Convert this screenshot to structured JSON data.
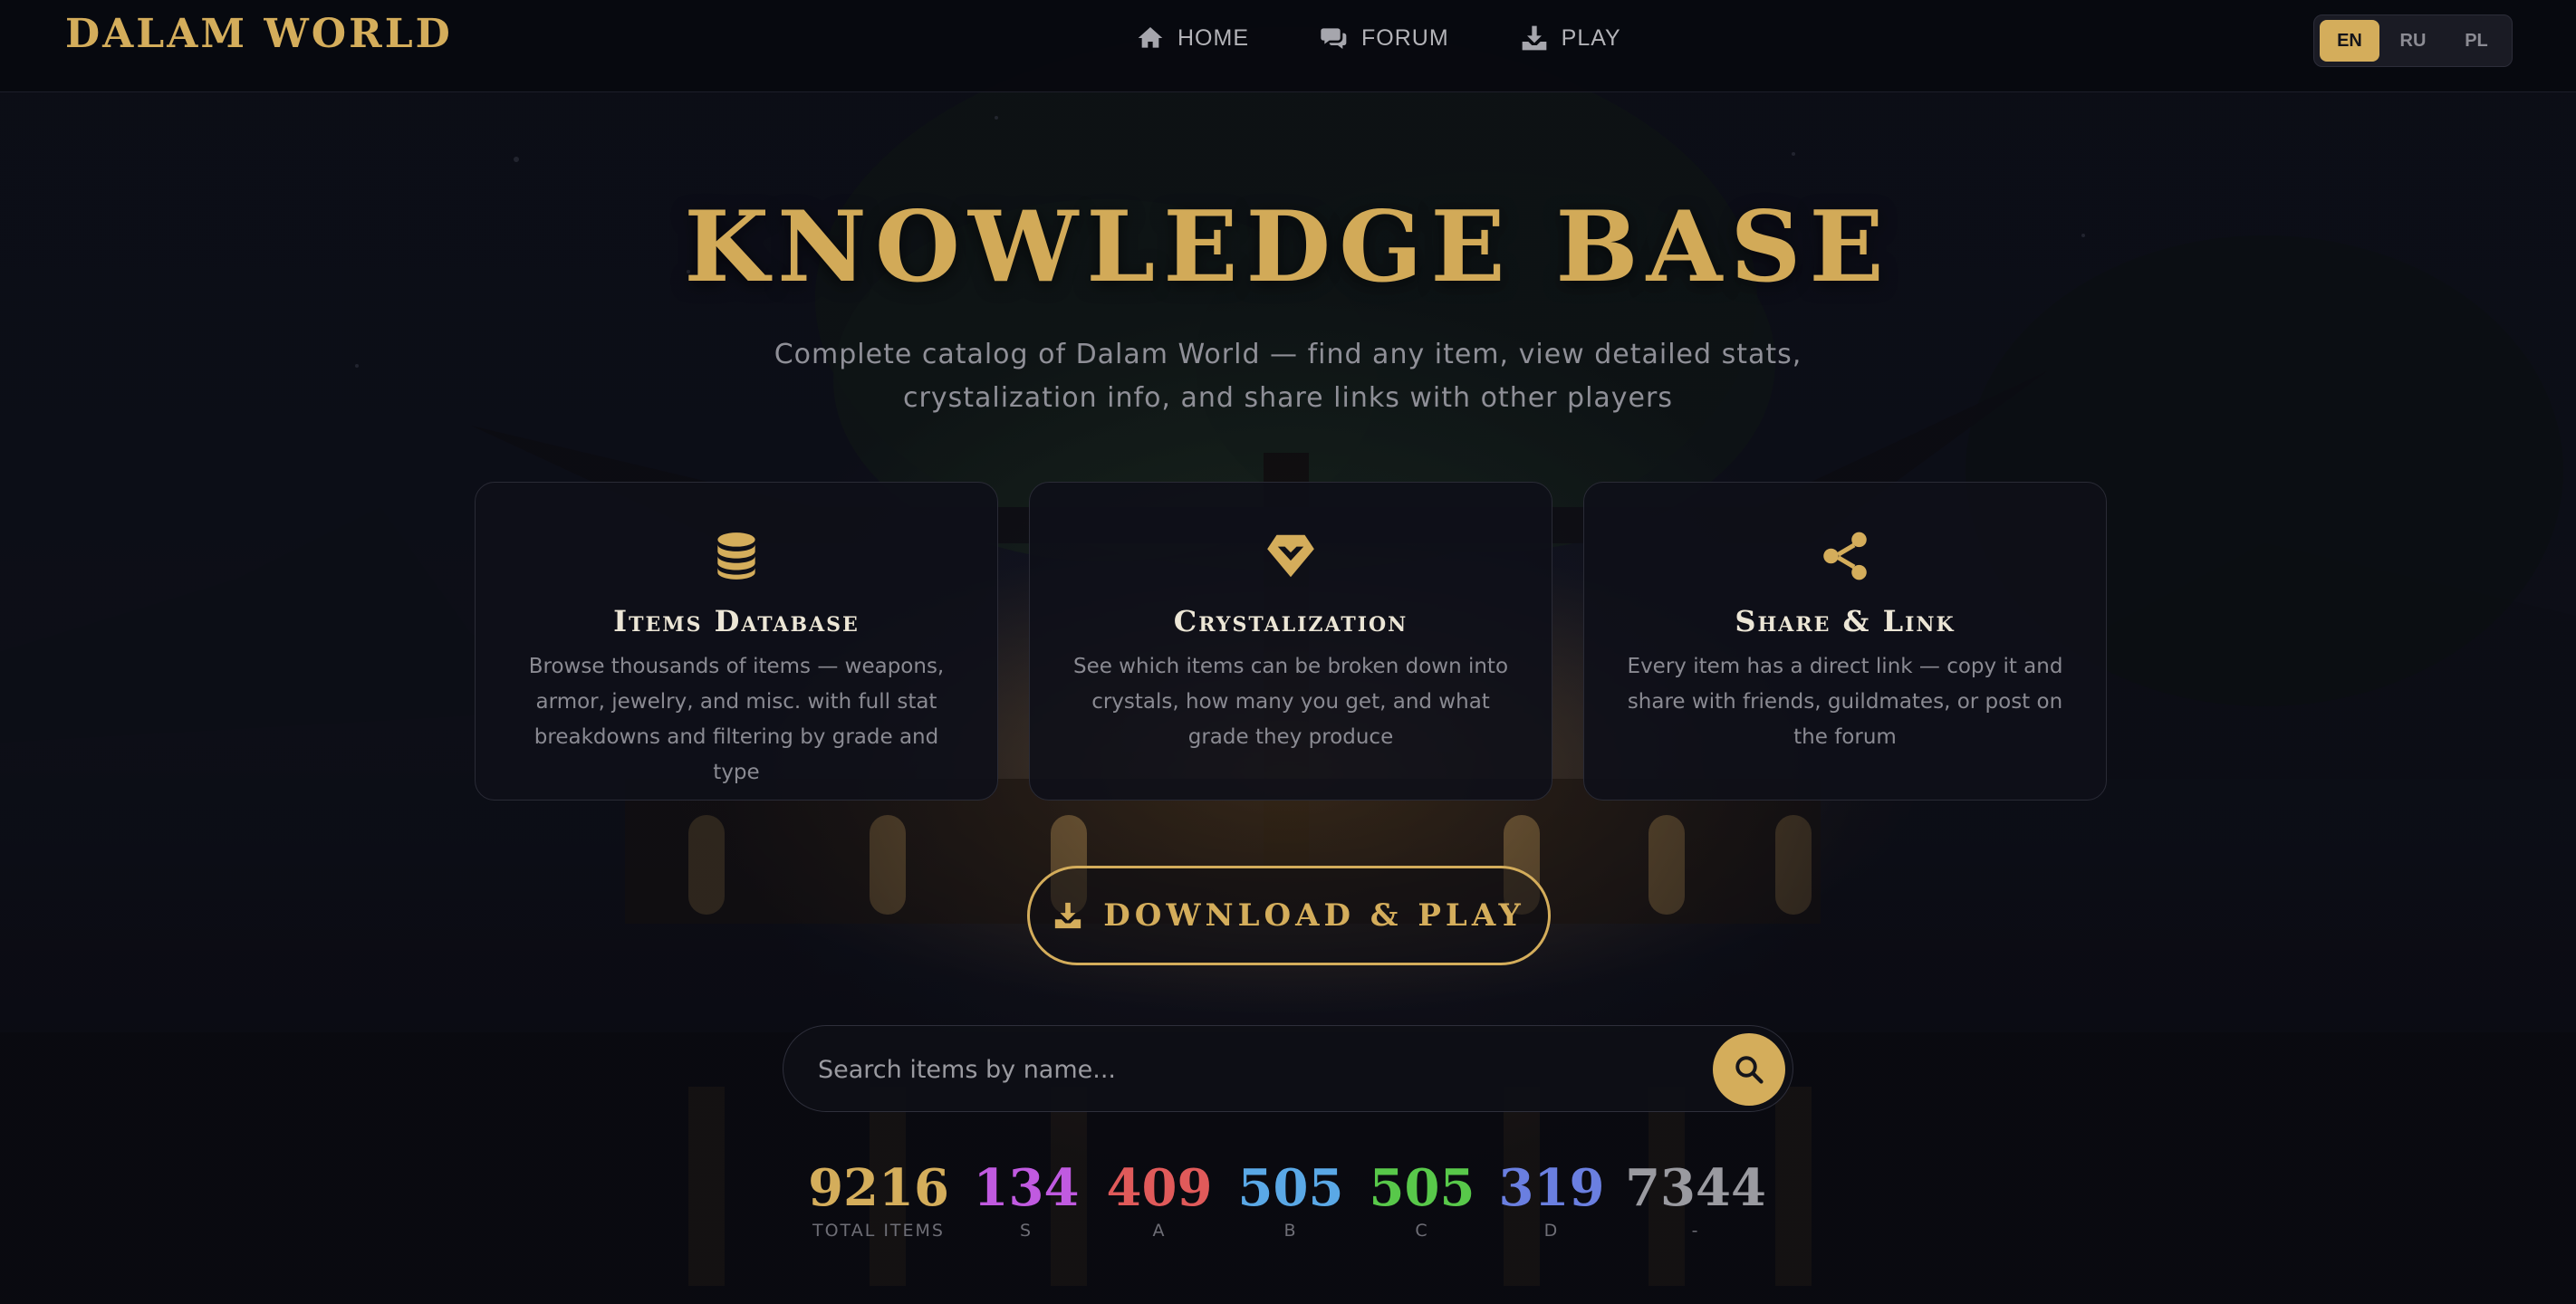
{
  "nav": {
    "logo": "DALAM WORLD",
    "links": [
      {
        "label": "HOME",
        "icon": "home-icon"
      },
      {
        "label": "FORUM",
        "icon": "comments-icon"
      },
      {
        "label": "PLAY",
        "icon": "download-icon"
      }
    ],
    "languages": [
      {
        "label": "EN",
        "active": true
      },
      {
        "label": "RU",
        "active": false
      },
      {
        "label": "PL",
        "active": false
      }
    ]
  },
  "hero": {
    "title": "KNOWLEDGE BASE",
    "subtitle": "Complete catalog of Dalam World — find any item, view detailed stats, crystalization info, and share links with other players"
  },
  "cards": [
    {
      "icon": "database-icon",
      "title": "Items Database",
      "description": "Browse thousands of items — weapons, armor, jewelry, and misc. with full stat breakdowns and filtering by grade and type"
    },
    {
      "icon": "gem-icon",
      "title": "Crystalization",
      "description": "See which items can be broken down into crystals, how many you get, and what grade they produce"
    },
    {
      "icon": "share-icon",
      "title": "Share & Link",
      "description": "Every item has a direct link — copy it and share with friends, guildmates, or post on the forum"
    }
  ],
  "download": {
    "label": "DOWNLOAD & PLAY",
    "icon": "download-icon"
  },
  "search": {
    "placeholder": "Search items by name...",
    "value": "",
    "button_icon": "search-icon"
  },
  "stats": [
    {
      "value": "9216",
      "label": "TOTAL ITEMS",
      "color": "#d4ad5b"
    },
    {
      "value": "134",
      "label": "S",
      "color": "#c05ae0"
    },
    {
      "value": "409",
      "label": "A",
      "color": "#e05a5a"
    },
    {
      "value": "505",
      "label": "B",
      "color": "#5aa8e6"
    },
    {
      "value": "505",
      "label": "C",
      "color": "#58c84a"
    },
    {
      "value": "319",
      "label": "D",
      "color": "#6a7fe0"
    },
    {
      "value": "7344",
      "label": "-",
      "color": "#9a9aa0"
    }
  ],
  "colors": {
    "accent": "#d4ad5b",
    "background": "#0b0c14"
  }
}
